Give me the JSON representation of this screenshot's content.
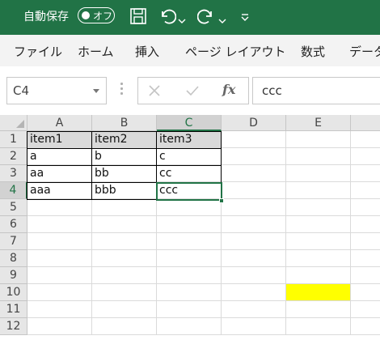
{
  "titlebar": {
    "autosave_label": "自動保存",
    "toggle_label": "オフ",
    "bg_color": "#217346"
  },
  "ribbon": {
    "tabs": [
      "ファイル",
      "ホーム",
      "挿入",
      "ページ レイアウト",
      "数式",
      "データ"
    ]
  },
  "formula_bar": {
    "name_box": "C4",
    "formula_value": "ccc",
    "fx_label": "fx"
  },
  "grid": {
    "columns": [
      "A",
      "B",
      "C",
      "D",
      "E"
    ],
    "selected_column": "C",
    "rows": [
      "1",
      "2",
      "3",
      "4",
      "5",
      "6",
      "7",
      "8",
      "9",
      "10",
      "11",
      "12"
    ],
    "selected_row": "4",
    "cells": {
      "A1": "item1",
      "B1": "item2",
      "C1": "item3",
      "A2": "a",
      "B2": "b",
      "C2": "c",
      "A3": "aa",
      "B3": "bb",
      "C3": "cc",
      "A4": "aaa",
      "B4": "bbb",
      "C4": "ccc"
    },
    "header_fill_color": "#d9d9d9",
    "highlight_cell": "E10",
    "highlight_color": "#ffff00"
  }
}
